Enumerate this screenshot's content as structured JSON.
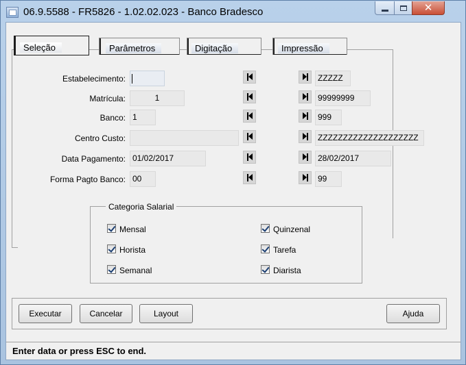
{
  "window": {
    "title": "06.9.5588 - FR5826 - 1.02.02.023 - Banco Bradesco"
  },
  "tabs": [
    {
      "label": "Seleção",
      "active": true
    },
    {
      "label": "Parâmetros",
      "active": false
    },
    {
      "label": "Digitação",
      "active": false
    },
    {
      "label": "Impressão",
      "active": false
    }
  ],
  "form": {
    "rows": [
      {
        "label": "Estabelecimento:",
        "from": "",
        "to": "ZZZZZ"
      },
      {
        "label": "Matrícula:",
        "from": "1",
        "to": "99999999"
      },
      {
        "label": "Banco:",
        "from": "1",
        "to": "999"
      },
      {
        "label": "Centro Custo:",
        "from": "",
        "to": "ZZZZZZZZZZZZZZZZZZZZ"
      },
      {
        "label": "Data Pagamento:",
        "from": "01/02/2017",
        "to": "28/02/2017"
      },
      {
        "label": "Forma Pagto Banco:",
        "from": "00",
        "to": "99"
      }
    ]
  },
  "categoria": {
    "title": "Categoria Salarial",
    "items": [
      {
        "label": "Mensal",
        "checked": true
      },
      {
        "label": "Quinzenal",
        "checked": true
      },
      {
        "label": "Horista",
        "checked": true
      },
      {
        "label": "Tarefa",
        "checked": true
      },
      {
        "label": "Semanal",
        "checked": true
      },
      {
        "label": "Diarista",
        "checked": true
      }
    ]
  },
  "buttons": {
    "executar": "Executar",
    "cancelar": "Cancelar",
    "layout": "Layout",
    "ajuda": "Ajuda"
  },
  "status": {
    "text": "Enter data or press ESC to end."
  },
  "icons": {
    "app": "window-app-icon",
    "first": "first-record-icon",
    "last": "last-record-icon"
  },
  "colors": {
    "title_bar": "#b9d1ea",
    "close_button": "#c94f36",
    "field_background": "#e9e9e9"
  }
}
